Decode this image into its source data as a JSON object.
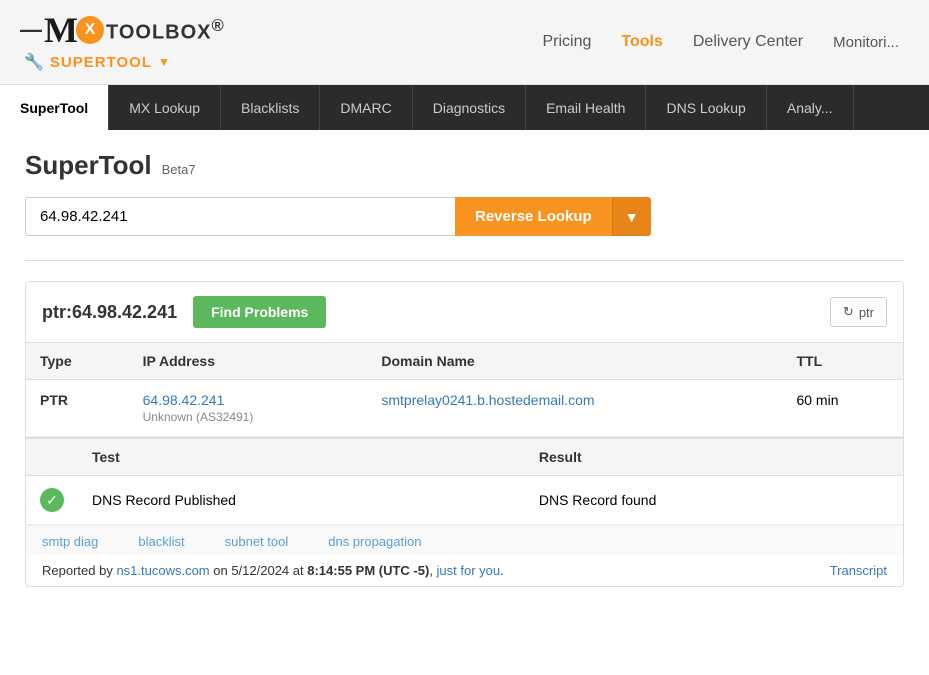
{
  "header": {
    "logo": {
      "dash": "—",
      "m": "M",
      "x": "X",
      "toolbox": "TOOLBOX",
      "reg": "®"
    },
    "supertool": {
      "label": "SUPERTOOL",
      "arrow": "▼"
    },
    "nav": {
      "pricing": "Pricing",
      "tools": "Tools",
      "delivery_center": "Delivery Center",
      "monitoring": "Monitori..."
    }
  },
  "tabs": [
    {
      "id": "supertool",
      "label": "SuperTool",
      "active": true
    },
    {
      "id": "mx-lookup",
      "label": "MX Lookup",
      "active": false
    },
    {
      "id": "blacklists",
      "label": "Blacklists",
      "active": false
    },
    {
      "id": "dmarc",
      "label": "DMARC",
      "active": false
    },
    {
      "id": "diagnostics",
      "label": "Diagnostics",
      "active": false
    },
    {
      "id": "email-health",
      "label": "Email Health",
      "active": false
    },
    {
      "id": "dns-lookup",
      "label": "DNS Lookup",
      "active": false
    },
    {
      "id": "analyze",
      "label": "Analy...",
      "active": false
    }
  ],
  "page": {
    "title": "SuperTool",
    "beta": "Beta7"
  },
  "search": {
    "value": "64.98.42.241",
    "button_label": "Reverse Lookup",
    "dropdown_arrow": "▼"
  },
  "ptr_section": {
    "address_label": "ptr:64.98.42.241",
    "find_problems_label": "Find Problems",
    "refresh_label": "ptr",
    "refresh_icon": "↻"
  },
  "results_table": {
    "columns": [
      "Type",
      "IP Address",
      "Domain Name",
      "TTL"
    ],
    "rows": [
      {
        "type": "PTR",
        "ip": "64.98.42.241",
        "ip_sub": "Unknown (AS32491)",
        "domain": "smtprelay0241.b.hostedemail.com",
        "ttl": "60 min"
      }
    ]
  },
  "test_table": {
    "columns": [
      "",
      "Test",
      "Result"
    ],
    "rows": [
      {
        "icon": "✓",
        "test": "DNS Record Published",
        "result": "DNS Record found"
      }
    ]
  },
  "footer": {
    "links": [
      "smtp diag",
      "blacklist",
      "subnet tool",
      "dns propagation"
    ],
    "reported_by": "Reported by",
    "server": "ns1.tucows.com",
    "on": "on",
    "date": "5/12/2024",
    "at": "at",
    "time": "8:14:55 PM (UTC -5),",
    "just_for_you": "just for you",
    "transcript": "Transcript"
  }
}
